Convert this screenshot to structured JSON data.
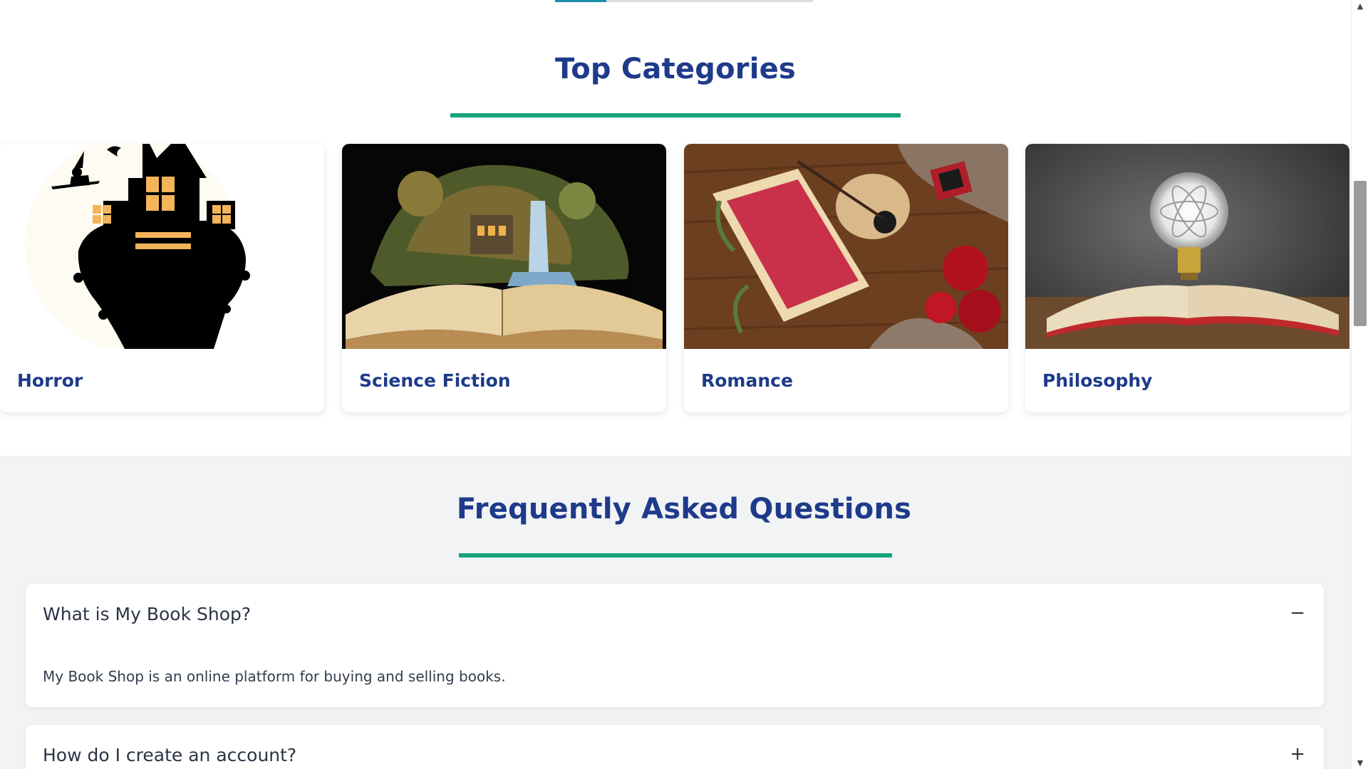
{
  "categories_section": {
    "title": "Top Categories",
    "items": [
      {
        "label": "Horror"
      },
      {
        "label": "Science Fiction"
      },
      {
        "label": "Romance"
      },
      {
        "label": "Philosophy"
      }
    ]
  },
  "faq_section": {
    "title": "Frequently Asked Questions",
    "items": [
      {
        "question": "What is My Book Shop?",
        "answer": "My Book Shop is an online platform for buying and selling books.",
        "toggle": "−",
        "expanded": true
      },
      {
        "question": "How do I create an account?",
        "toggle": "+",
        "expanded": false
      }
    ]
  },
  "colors": {
    "heading": "#1e3a8a",
    "accent_underline": "#16a37a",
    "page_background": "#f2f3f5"
  }
}
